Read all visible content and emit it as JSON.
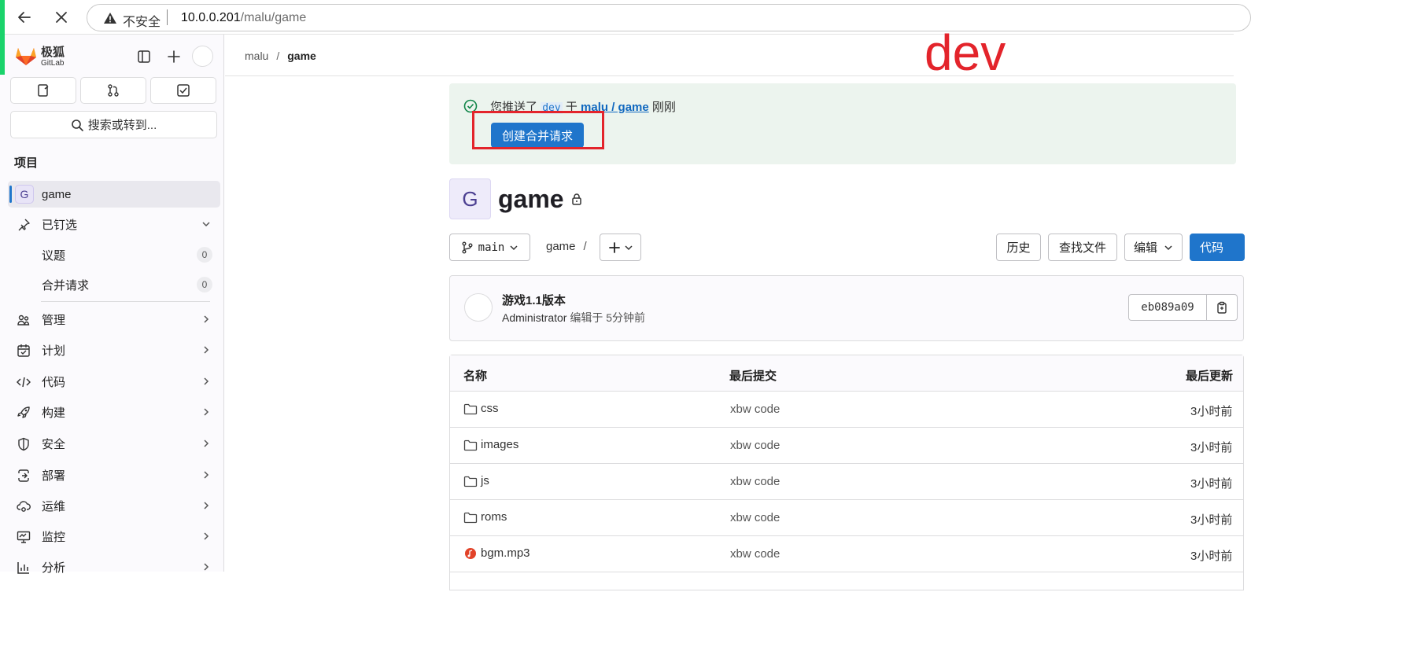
{
  "browser": {
    "insecure_label": "不安全",
    "url_host": "10.0.0.201",
    "url_path": "/malu/game"
  },
  "sidebar": {
    "logo_zh": "极狐",
    "logo_en": "GitLab",
    "search_label": "搜索或转到...",
    "section_title": "项目",
    "project_badge": "G",
    "project_name": "game",
    "pinned_label": "已钉选",
    "pinned": [
      {
        "label": "议题",
        "count": "0"
      },
      {
        "label": "合并请求",
        "count": "0"
      }
    ],
    "menu": [
      {
        "label": "管理",
        "icon": "users-icon"
      },
      {
        "label": "计划",
        "icon": "calendar-icon"
      },
      {
        "label": "代码",
        "icon": "code-icon"
      },
      {
        "label": "构建",
        "icon": "rocket-icon"
      },
      {
        "label": "安全",
        "icon": "shield-icon"
      },
      {
        "label": "部署",
        "icon": "deploy-icon"
      },
      {
        "label": "运维",
        "icon": "cloud-gear-icon"
      },
      {
        "label": "监控",
        "icon": "monitor-icon"
      },
      {
        "label": "分析",
        "icon": "chart-icon"
      }
    ]
  },
  "header": {
    "breadcrumb_parent": "malu",
    "breadcrumb_separator": "/",
    "breadcrumb_current": "game"
  },
  "annotation": {
    "dev_label": "dev",
    "color": "#e3242b"
  },
  "alert": {
    "prefix": "您推送了",
    "branch": "dev",
    "middle": "于",
    "project_link": "malu / game",
    "suffix": "刚刚",
    "button_label": "创建合并请求"
  },
  "project": {
    "avatar_letter": "G",
    "name": "game"
  },
  "toolbar": {
    "branch": "main",
    "path": "game",
    "path_sep": "/",
    "history": "历史",
    "find_file": "查找文件",
    "edit": "编辑",
    "code": "代码"
  },
  "commit": {
    "title": "游戏1.1版本",
    "author": "Administrator",
    "meta": "编辑于 5分钟前",
    "sha": "eb089a09"
  },
  "file_table": {
    "col_name": "名称",
    "col_last_commit": "最后提交",
    "col_last_update": "最后更新",
    "rows": [
      {
        "name": "css",
        "type": "folder",
        "commit": "xbw code",
        "updated": "3小时前"
      },
      {
        "name": "images",
        "type": "folder",
        "commit": "xbw code",
        "updated": "3小时前"
      },
      {
        "name": "js",
        "type": "folder",
        "commit": "xbw code",
        "updated": "3小时前"
      },
      {
        "name": "roms",
        "type": "folder",
        "commit": "xbw code",
        "updated": "3小时前"
      },
      {
        "name": "bgm.mp3",
        "type": "audio",
        "commit": "xbw code",
        "updated": "3小时前"
      }
    ]
  },
  "colors": {
    "accent": "#1f75cb",
    "alert_bg": "#ecf4ee",
    "success": "#108548"
  }
}
